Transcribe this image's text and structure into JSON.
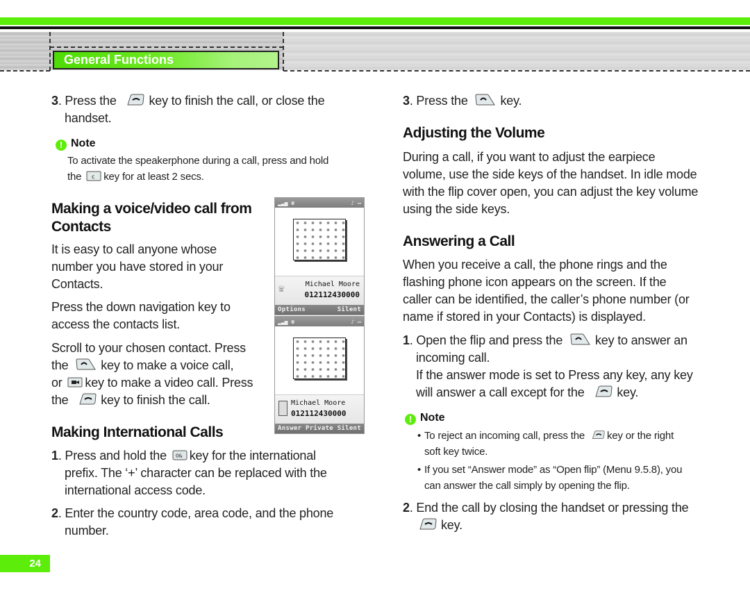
{
  "header": {
    "section_title": "General Functions",
    "accent_color": "#5ded0a"
  },
  "left_column": {
    "step3": {
      "number": "3",
      "text_before": "Press the",
      "key_icon": "end-call-key",
      "text_after_line1": "key to finish the call, or close the",
      "text_line2": "handset."
    },
    "note1": {
      "heading": "Note",
      "line1": "To activate the speakerphone during a call, press and hold",
      "line2_before": "the",
      "key_icon": "clear-c-key",
      "key_label": "c",
      "line2_after": "key for at least 2 secs."
    },
    "contacts_section": {
      "heading_line1": "Making a voice/video call from",
      "heading_line2": "Contacts",
      "para1": [
        "It is easy to call anyone whose",
        "number you have stored in your",
        "Contacts."
      ],
      "para2": [
        "Press the down navigation key to",
        "access the contacts list."
      ],
      "para3_line1": "Scroll to your chosen contact. Press",
      "para3_line2_before": "the",
      "para3_line2_after": "key to make a voice call,",
      "para3_line3_before": "or",
      "para3_line3_after": "key to make a video call. Press",
      "para3_line4_before": "the",
      "para3_line4_after": "key to finish the call."
    },
    "international_section": {
      "heading": "Making International Calls",
      "step1": {
        "number": "1",
        "line1_before": "Press and hold the",
        "key_label": "0&",
        "line1_after": "key for the international",
        "line2": "prefix. The ‘+’ character can be replaced with the",
        "line3": "international access code."
      },
      "step2": {
        "number": "2",
        "line1": "Enter the country code, area code, and the phone",
        "line2": "number."
      }
    }
  },
  "phone_screens": [
    {
      "contact_name": "Michael Moore",
      "contact_number": "012112430000",
      "softkeys": [
        "Options",
        "Silent"
      ],
      "caller_icon": "voice-call-icon"
    },
    {
      "contact_name": "Michael Moore",
      "contact_number": "012112430000",
      "softkeys": [
        "Answer",
        "Private",
        "Silent"
      ],
      "caller_icon": "video-call-icon"
    }
  ],
  "right_column": {
    "step3": {
      "number": "3",
      "before": "Press the",
      "after": "key."
    },
    "volume_section": {
      "heading": "Adjusting the Volume",
      "lines": [
        "During a call, if you want to adjust the earpiece",
        "volume, use the side keys of the handset. In idle mode",
        "with the flip cover open, you can adjust the key volume",
        "using the side keys."
      ]
    },
    "answering_section": {
      "heading": "Answering a Call",
      "lines": [
        "When you receive a call, the phone rings and the",
        "flashing phone icon appears on the screen. If the",
        "caller can be identified, the caller’s phone number (or",
        "name if stored in your Contacts) is displayed."
      ],
      "step1": {
        "number": "1",
        "line1_before": "Open the flip and press the",
        "line1_after": "key to answer an",
        "line2": "incoming call.",
        "line3": "If the answer mode is set to Press any key, any key",
        "line4_before": "will answer a call except for the",
        "line4_after": "key."
      },
      "note": {
        "heading": "Note",
        "bullet1_before": "To reject an incoming call, press the",
        "bullet1_after": "key or the right",
        "bullet1_line2": "soft key twice.",
        "bullet2_line1": "If you set “Answer mode” as “Open flip” (Menu 9.5.8), you",
        "bullet2_line2": "can answer the call simply by opening the flip."
      },
      "step2": {
        "number": "2",
        "line1": "End the call by closing the handset or pressing the",
        "line2_after": "key."
      }
    }
  },
  "footer": {
    "page_number": "24"
  }
}
